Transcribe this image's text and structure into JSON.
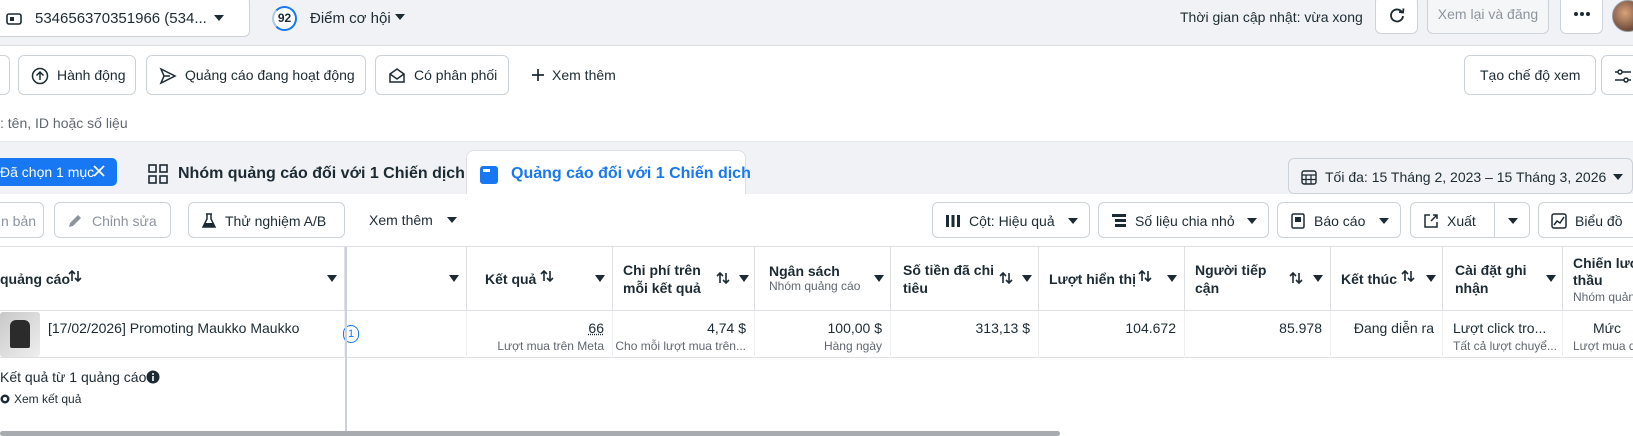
{
  "topbar": {
    "account_label": "534656370351966 (534...",
    "score_value": "92",
    "score_label": "Điểm cơ hội",
    "update_time": "Thời gian cập nhật: vừa xong",
    "review_publish_label": "Xem lại và đăng"
  },
  "filters": {
    "actions_label": "Hành động",
    "active_ads_label": "Quảng cáo đang hoạt động",
    "delivered_label": "Có phân phối",
    "see_more_label": "Xem thêm",
    "create_view_label": "Tạo chế độ xem"
  },
  "search": {
    "placeholder": ": tên, ID hoặc số liệu"
  },
  "tabs": {
    "selected_chip": "Đã chọn 1 mục",
    "adsets_tab": "Nhóm quảng cáo đối với 1 Chiến dịch",
    "ads_tab": "Quảng cáo đối với 1 Chiến dịch",
    "date_range": "Tối đa: 15 Tháng 2, 2023 – 15 Tháng 3, 2026"
  },
  "toolbar": {
    "duplicate_label": "n bản",
    "edit_label": "Chỉnh sửa",
    "ab_test_label": "Thử nghiệm A/B",
    "more_label": "Xem thêm",
    "columns_label": "Cột: Hiệu quả",
    "breakdown_label": "Số liệu chia nhỏ",
    "reports_label": "Báo cáo",
    "export_label": "Xuất",
    "chart_label": "Biểu đồ"
  },
  "table": {
    "headers": {
      "ad_name": "quảng cáo",
      "results": "Kết quả",
      "cost_per_result": [
        "Chi phí trên",
        "mỗi kết quả"
      ],
      "budget": "Ngân sách",
      "budget_sub": "Nhóm quảng cáo",
      "amount_spent": [
        "Số tiền đã chi",
        "tiêu"
      ],
      "impressions": "Lượt hiển thị",
      "reach": [
        "Người tiếp",
        "cận"
      ],
      "ends": "Kết thúc",
      "attribution": [
        "Cài đặt ghi",
        "nhận"
      ],
      "bid_strategy": [
        "Chiến lược",
        "thầu"
      ],
      "bid_strategy_sub": "Nhóm quản"
    },
    "row": {
      "name": "[17/02/2026] Promoting Maukko Maukko",
      "badge": "1",
      "results": "66",
      "results_sub": "Lượt mua trên Meta",
      "cost": "4,74 $",
      "cost_sub": "Cho mỗi lượt mua trên...",
      "budget": "100,00 $",
      "budget_sub": "Hàng ngày",
      "spent": "313,13 $",
      "impressions": "104.672",
      "reach": "85.978",
      "ends": "Đang diễn ra",
      "attribution": "Lượt click tro...",
      "attribution_sub": "Tất cả lượt chuyể...",
      "bid": "Mức",
      "bid_sub": "Lượt mua q"
    },
    "summary": {
      "label": "Kết quả từ 1 quảng cáo",
      "link": "Xem kết quả"
    }
  }
}
